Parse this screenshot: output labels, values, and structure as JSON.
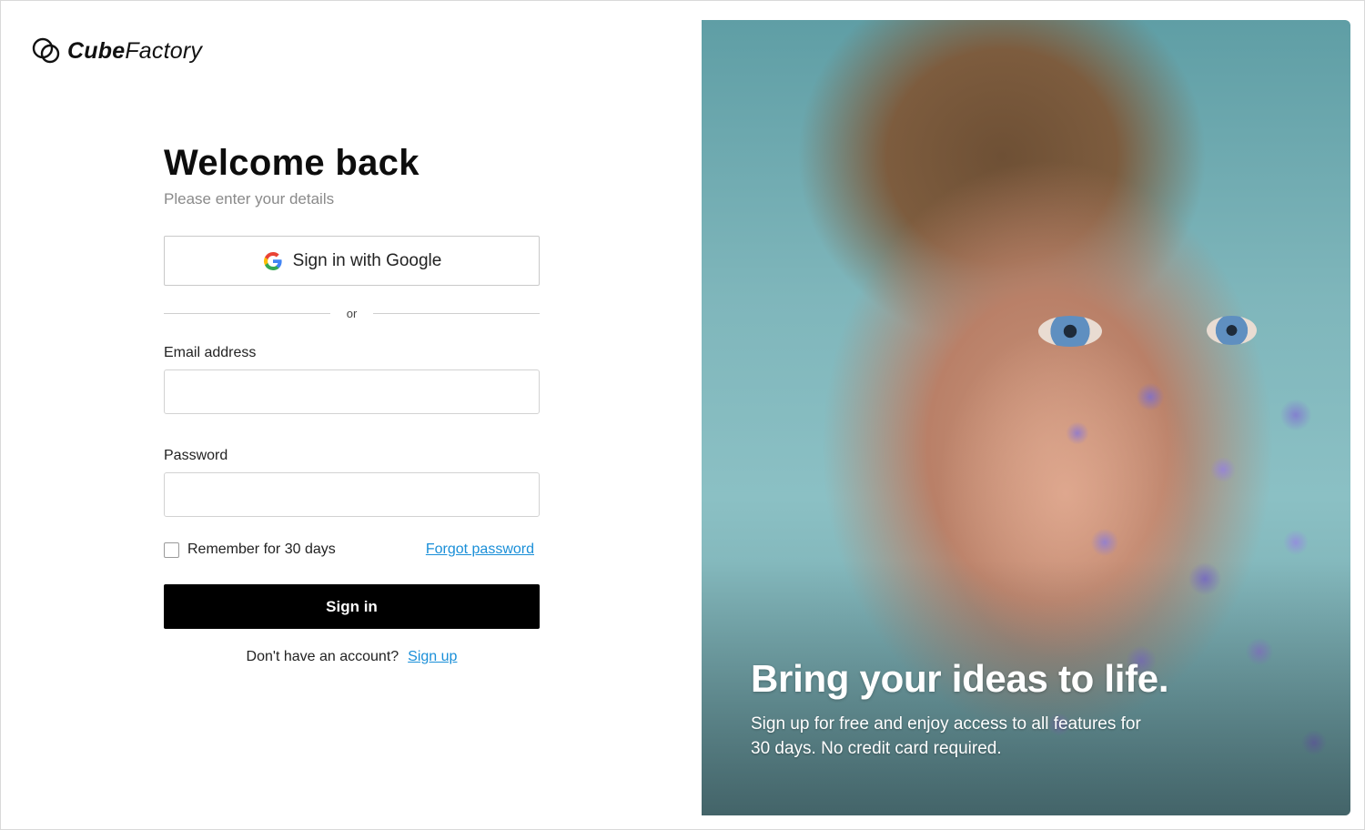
{
  "brand": {
    "name_bold": "Cube",
    "name_light": "Factory"
  },
  "form": {
    "title": "Welcome back",
    "subtitle": "Please enter your details",
    "google_button": "Sign in with Google",
    "divider_text": "or",
    "email_label": "Email address",
    "email_value": "",
    "password_label": "Password",
    "password_value": "",
    "remember_label": "Remember for 30 days",
    "remember_checked": false,
    "forgot_link": "Forgot password",
    "signin_button": "Sign in",
    "signup_prompt": "Don't have an account?",
    "signup_link": "Sign up"
  },
  "hero": {
    "headline": "Bring your ideas to life.",
    "subtext": "Sign up for free and enjoy access to all features for 30 days. No credit card required."
  },
  "colors": {
    "link": "#1a8fd8",
    "primary_button": "#000000",
    "text": "#111111",
    "muted": "#8a8a8a"
  },
  "icons": [
    "cubefactory-logo-icon",
    "google-icon"
  ]
}
